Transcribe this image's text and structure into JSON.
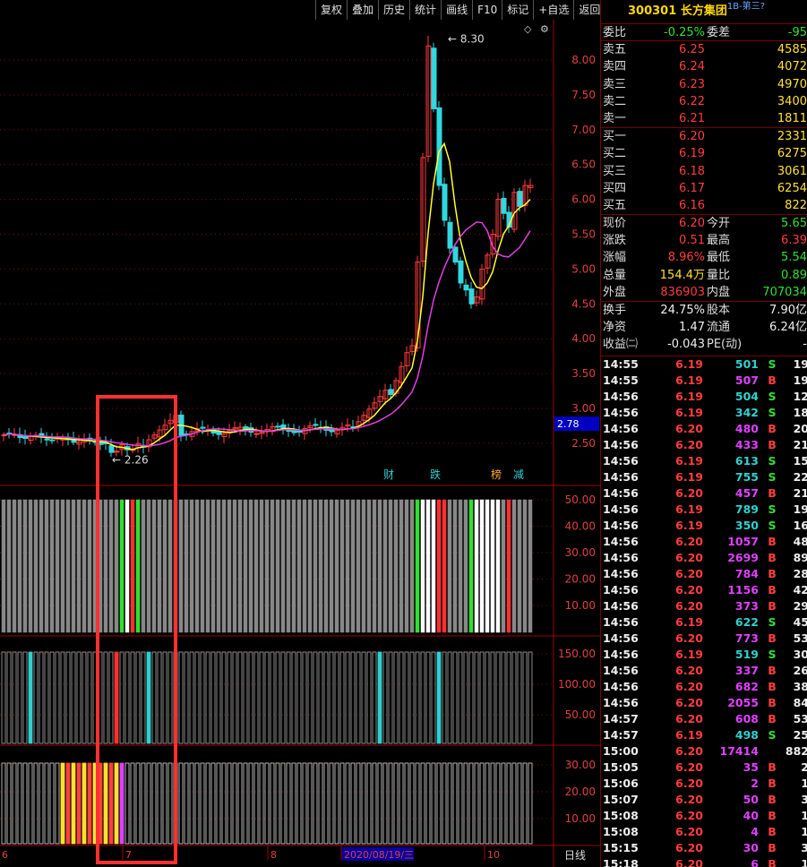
{
  "toolbar": [
    "复权",
    "叠加",
    "历史",
    "统计",
    "画线",
    "F10",
    "标记",
    "+自选",
    "返回"
  ],
  "stock": {
    "code": "300301",
    "name": "长方集团",
    "sub": "1B-第三?"
  },
  "weibi": {
    "label1": "委比",
    "value1": "-0.25%",
    "label2": "委差",
    "value2": "-95"
  },
  "asks": [
    {
      "label": "卖五",
      "price": "6.25",
      "volume": "4585"
    },
    {
      "label": "卖四",
      "price": "6.24",
      "volume": "4072"
    },
    {
      "label": "卖三",
      "price": "6.23",
      "volume": "4970"
    },
    {
      "label": "卖二",
      "price": "6.22",
      "volume": "3400"
    },
    {
      "label": "卖一",
      "price": "6.21",
      "volume": "1811"
    }
  ],
  "bids": [
    {
      "label": "买一",
      "price": "6.20",
      "volume": "2331"
    },
    {
      "label": "买二",
      "price": "6.19",
      "volume": "6275"
    },
    {
      "label": "买三",
      "price": "6.18",
      "volume": "3061"
    },
    {
      "label": "买四",
      "price": "6.17",
      "volume": "6254"
    },
    {
      "label": "买五",
      "price": "6.16",
      "volume": "822"
    }
  ],
  "quote": [
    {
      "l1": "现价",
      "v1": "6.20",
      "c1": "red",
      "l2": "今开",
      "v2": "5.65",
      "c2": "green"
    },
    {
      "l1": "涨跌",
      "v1": "0.51",
      "c1": "red",
      "l2": "最高",
      "v2": "6.39",
      "c2": "red"
    },
    {
      "l1": "涨幅",
      "v1": "8.96%",
      "c1": "red",
      "l2": "最低",
      "v2": "5.54",
      "c2": "green"
    },
    {
      "l1": "总量",
      "v1": "154.4万",
      "c1": "yellow",
      "l2": "量比",
      "v2": "0.89",
      "c2": "green"
    },
    {
      "l1": "外盘",
      "v1": "836903",
      "c1": "red",
      "l2": "内盘",
      "v2": "707034",
      "c2": "green"
    }
  ],
  "stats": [
    {
      "l1": "换手",
      "v1": "24.75%",
      "l2": "股本",
      "v2": "7.90亿"
    },
    {
      "l1": "净资",
      "v1": "1.47",
      "l2": "流通",
      "v2": "6.24亿"
    },
    {
      "l1": "收益㈡",
      "v1": "-0.043",
      "l2": "PE(动)",
      "v2": "-"
    }
  ],
  "ticks": [
    [
      "14:55",
      "6.19",
      "501",
      "S",
      "19"
    ],
    [
      "14:55",
      "6.19",
      "507",
      "B",
      "19"
    ],
    [
      "14:56",
      "6.19",
      "504",
      "S",
      "12"
    ],
    [
      "14:56",
      "6.19",
      "342",
      "S",
      "18"
    ],
    [
      "14:56",
      "6.20",
      "480",
      "B",
      "20"
    ],
    [
      "14:56",
      "6.20",
      "433",
      "B",
      "21"
    ],
    [
      "14:56",
      "6.19",
      "613",
      "S",
      "15"
    ],
    [
      "14:56",
      "6.19",
      "755",
      "S",
      "22"
    ],
    [
      "14:56",
      "6.20",
      "457",
      "B",
      "21"
    ],
    [
      "14:56",
      "6.19",
      "789",
      "S",
      "19"
    ],
    [
      "14:56",
      "6.19",
      "350",
      "S",
      "16"
    ],
    [
      "14:56",
      "6.20",
      "1057",
      "B",
      "48"
    ],
    [
      "14:56",
      "6.20",
      "2699",
      "B",
      "89"
    ],
    [
      "14:56",
      "6.20",
      "784",
      "B",
      "28"
    ],
    [
      "14:56",
      "6.20",
      "1156",
      "B",
      "42"
    ],
    [
      "14:56",
      "6.20",
      "373",
      "B",
      "29"
    ],
    [
      "14:56",
      "6.19",
      "622",
      "S",
      "45"
    ],
    [
      "14:56",
      "6.20",
      "773",
      "B",
      "53"
    ],
    [
      "14:56",
      "6.19",
      "519",
      "S",
      "30"
    ],
    [
      "14:56",
      "6.20",
      "337",
      "B",
      "26"
    ],
    [
      "14:56",
      "6.20",
      "682",
      "B",
      "38"
    ],
    [
      "14:56",
      "6.20",
      "2055",
      "B",
      "84"
    ],
    [
      "14:57",
      "6.20",
      "608",
      "B",
      "53"
    ],
    [
      "14:57",
      "6.19",
      "498",
      "S",
      "25"
    ],
    [
      "15:00",
      "6.20",
      "17414",
      "",
      "882"
    ],
    [
      "15:05",
      "6.20",
      "35",
      "B",
      "2"
    ],
    [
      "15:06",
      "6.20",
      "2",
      "B",
      "1"
    ],
    [
      "15:07",
      "6.20",
      "50",
      "B",
      "3"
    ],
    [
      "15:08",
      "6.20",
      "40",
      "B",
      "1"
    ],
    [
      "15:08",
      "6.20",
      "4",
      "B",
      "1"
    ],
    [
      "15:15",
      "6.20",
      "30",
      "B",
      "3"
    ],
    [
      "15:18",
      "6.20",
      "6",
      "B",
      "1"
    ]
  ],
  "price_axis": [
    "8.00",
    "7.50",
    "7.00",
    "6.50",
    "6.00",
    "5.50",
    "5.00",
    "4.50",
    "4.00",
    "3.50",
    "3.00",
    "2.50"
  ],
  "current_price_tag": "2.78",
  "high_label": "8.30",
  "low_label": "2.26",
  "event_tags": [
    "财",
    "跌",
    "榜",
    "减"
  ],
  "vol1_axis": [
    "50.00",
    "40.00",
    "30.00",
    "20.00",
    "10.00"
  ],
  "vol2_axis": [
    "150.00",
    "100.00",
    "50.00"
  ],
  "vol3_axis": [
    "30.00",
    "20.00",
    "10.00"
  ],
  "date_axis": [
    "6",
    "7",
    "8",
    "2020/08/19/三",
    "10"
  ],
  "period_label": "日线",
  "colors": {
    "up": "#ff3c3c",
    "down": "#30d8e0",
    "ma5": "#ffff30",
    "ma10": "#e040e0",
    "highlight": "#ff3030"
  }
}
